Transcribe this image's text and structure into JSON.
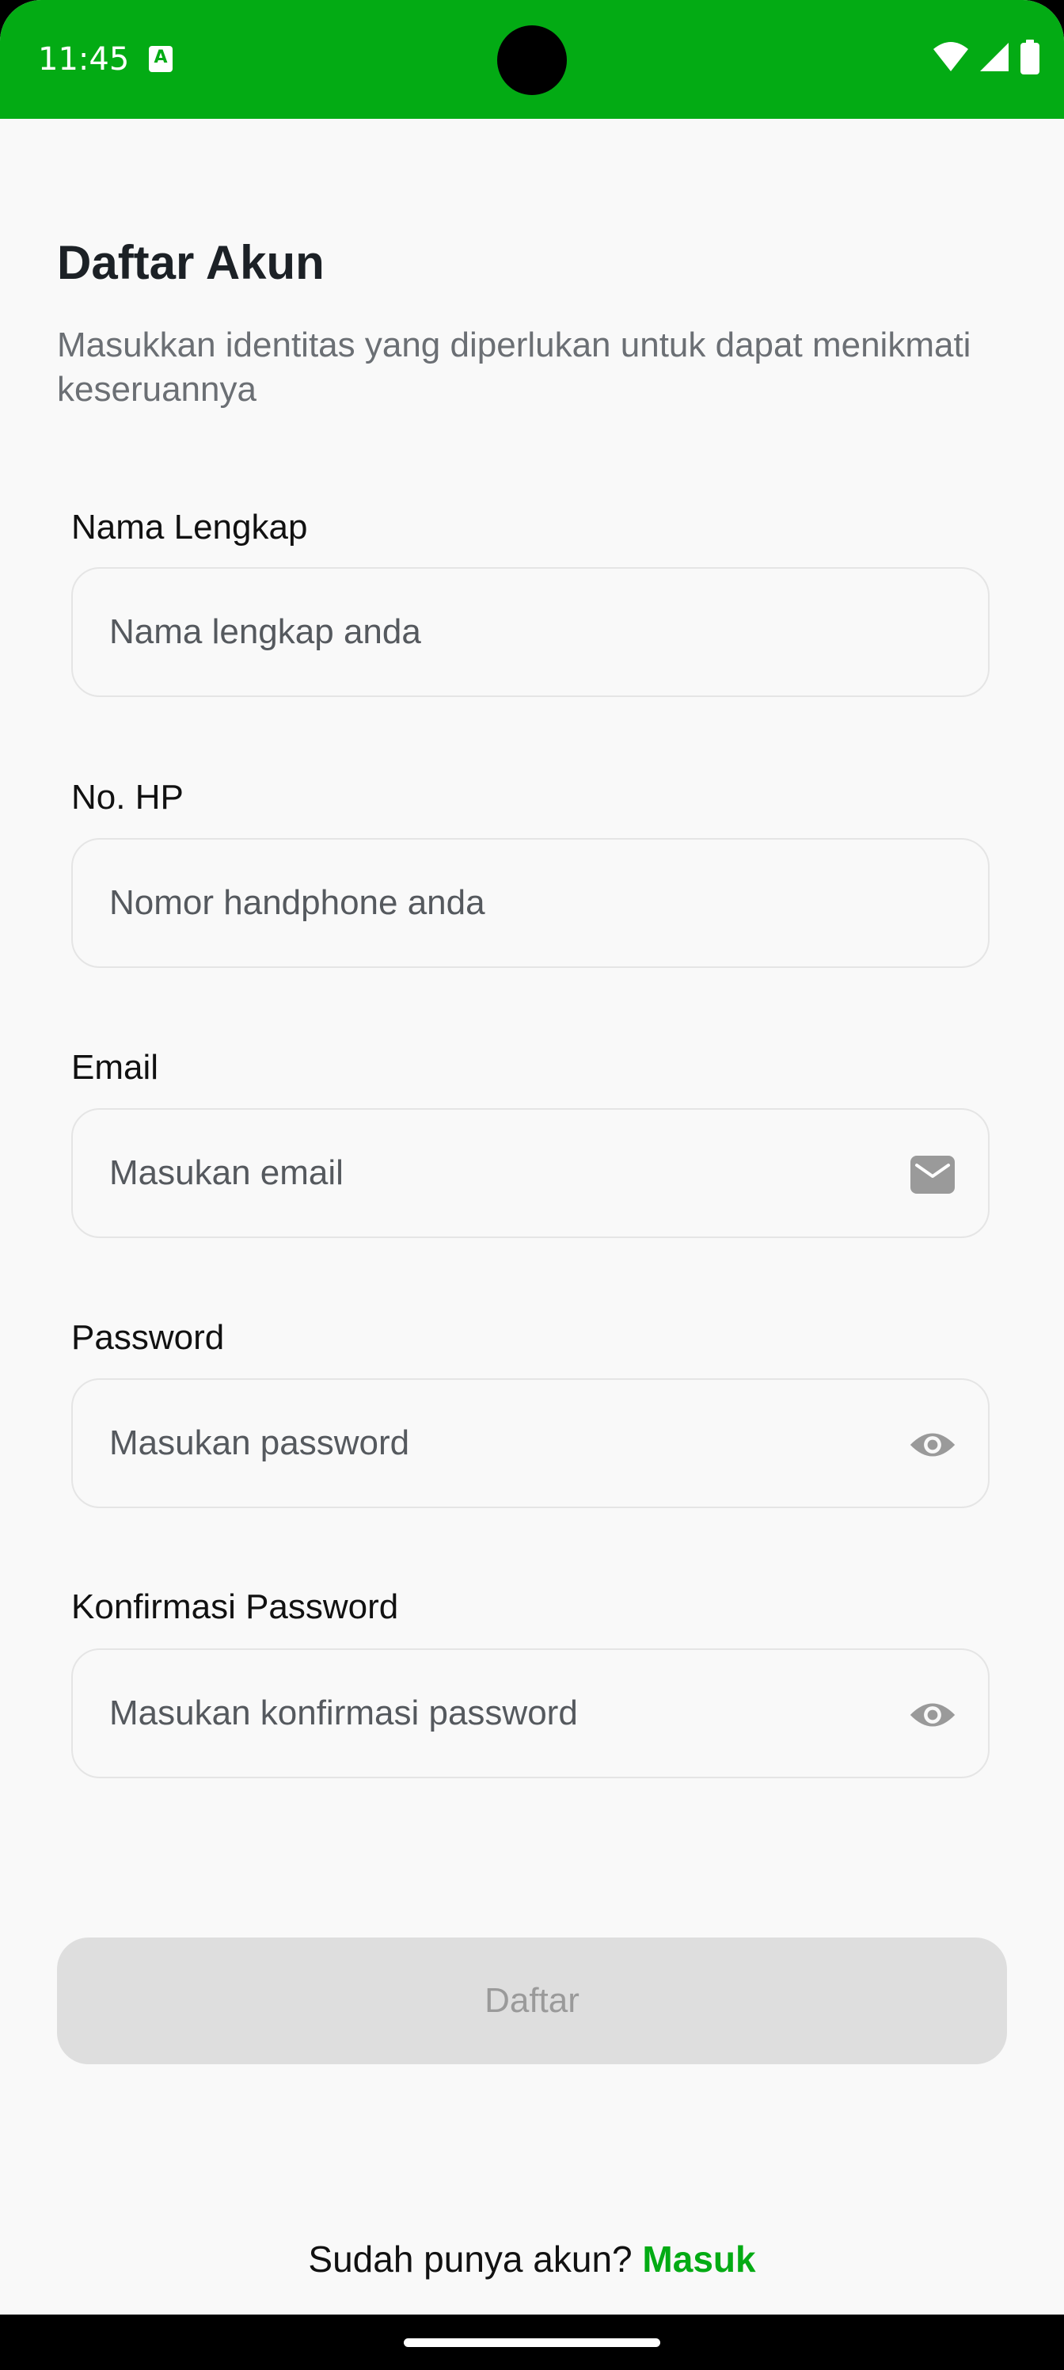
{
  "status_bar": {
    "time": "11:45",
    "app_icon_glyph": "A",
    "icons": [
      "wifi-icon",
      "signal-icon",
      "battery-icon"
    ],
    "background_color": "#03ab14"
  },
  "header": {
    "title": "Daftar Akun",
    "subtitle": "Masukkan identitas yang diperlukan untuk dapat menikmati keseruannya"
  },
  "form": {
    "full_name": {
      "label": "Nama Lengkap",
      "placeholder": "Nama lengkap anda",
      "value": ""
    },
    "phone": {
      "label": "No. HP",
      "placeholder": "Nomor handphone anda",
      "value": ""
    },
    "email": {
      "label": "Email",
      "placeholder": "Masukan email",
      "value": "",
      "icon": "mail-icon"
    },
    "password": {
      "label": "Password",
      "placeholder": "Masukan password",
      "value": "",
      "icon": "eye-icon"
    },
    "confirm_password": {
      "label": "Konfirmasi Password",
      "placeholder": "Masukan konfirmasi password",
      "value": "",
      "icon": "eye-icon"
    }
  },
  "submit": {
    "label": "Daftar",
    "state": "disabled"
  },
  "footer": {
    "prompt": "Sudah punya akun?",
    "login_link": "Masuk"
  },
  "colors": {
    "accent": "#03ab14",
    "background": "#f9f9f9",
    "title": "#1c2126",
    "subtitle": "#6b6f74",
    "button_disabled_bg": "#dedede",
    "button_disabled_text": "#9a9a9a"
  }
}
